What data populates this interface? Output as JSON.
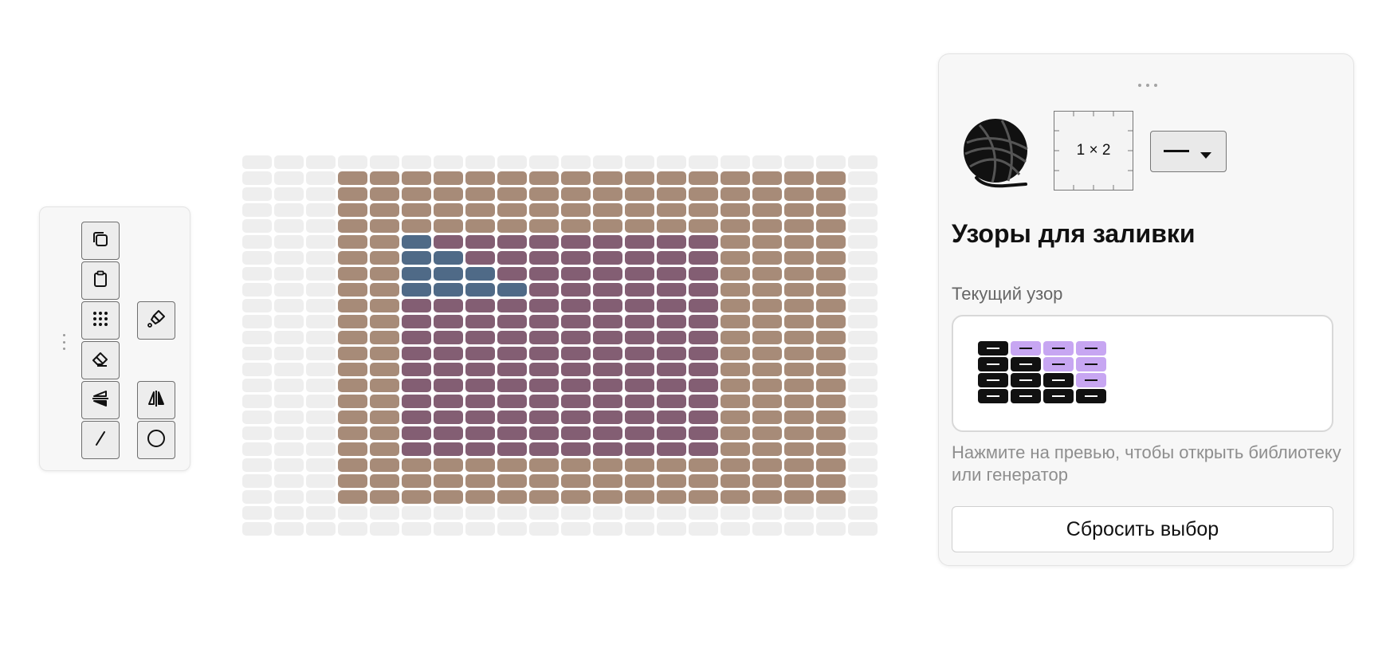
{
  "toolbar": {
    "tools": [
      {
        "name": "copy-icon"
      },
      {
        "name": "clipboard-icon"
      },
      {
        "name": "dots-grid-icon"
      },
      {
        "name": "eraser-icon"
      },
      {
        "name": "mirror-horizontal-icon"
      },
      {
        "name": "line-icon"
      },
      {
        "name": "fill-bucket-icon"
      },
      {
        "name": "mirror-vertical-icon"
      },
      {
        "name": "circle-icon"
      }
    ]
  },
  "canvas": {
    "columns": 20,
    "rows": 24,
    "colors": {
      "empty": "#eeeeee",
      "beige": "#a78b78",
      "purple": "#835e73",
      "blue": "#4f6a87"
    },
    "fill_regions": [
      {
        "color": "beige",
        "rows": [
          1,
          21
        ],
        "cols": [
          3,
          18
        ]
      },
      {
        "color": "purple",
        "rows": [
          5,
          18
        ],
        "cols": [
          5,
          14
        ]
      },
      {
        "color": "blue",
        "cells": [
          [
            5,
            5
          ],
          [
            6,
            5
          ],
          [
            6,
            6
          ],
          [
            7,
            5
          ],
          [
            7,
            6
          ],
          [
            7,
            7
          ],
          [
            8,
            5
          ],
          [
            8,
            6
          ],
          [
            8,
            7
          ],
          [
            8,
            8
          ]
        ]
      }
    ]
  },
  "panel": {
    "gauge_label": "1 × 2",
    "title": "Узоры для заливки",
    "current_pattern_label": "Текущий узор",
    "current_pattern": {
      "colors": {
        "black": "#111111",
        "lilac": "#c7a6f2"
      },
      "rows": [
        [
          "black",
          "lilac",
          "lilac",
          "lilac"
        ],
        [
          "black",
          "black",
          "lilac",
          "lilac"
        ],
        [
          "black",
          "black",
          "black",
          "lilac"
        ],
        [
          "black",
          "black",
          "black",
          "black"
        ]
      ]
    },
    "hint": "Нажмите на превью, чтобы открыть библиотеку или генератор",
    "reset_button": "Сбросить выбор"
  }
}
